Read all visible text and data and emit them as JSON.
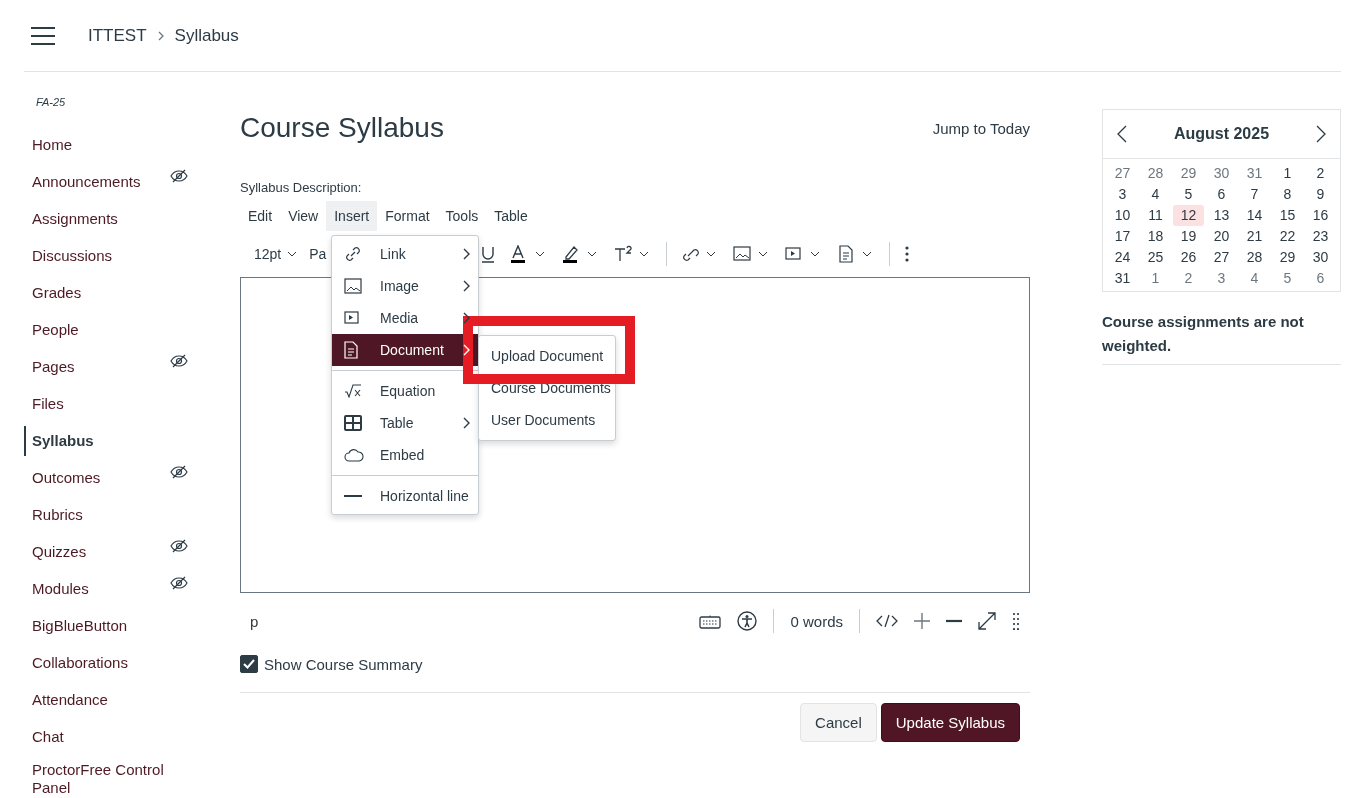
{
  "breadcrumb": [
    "ITTEST",
    "Syllabus"
  ],
  "sidebar": {
    "term": "FA-25",
    "items": [
      {
        "label": "Home",
        "selected": false,
        "hidden": false
      },
      {
        "label": "Announcements",
        "selected": false,
        "hidden": true
      },
      {
        "label": "Assignments",
        "selected": false,
        "hidden": false
      },
      {
        "label": "Discussions",
        "selected": false,
        "hidden": false
      },
      {
        "label": "Grades",
        "selected": false,
        "hidden": false
      },
      {
        "label": "People",
        "selected": false,
        "hidden": false
      },
      {
        "label": "Pages",
        "selected": false,
        "hidden": true
      },
      {
        "label": "Files",
        "selected": false,
        "hidden": false
      },
      {
        "label": "Syllabus",
        "selected": true,
        "hidden": false
      },
      {
        "label": "Outcomes",
        "selected": false,
        "hidden": true
      },
      {
        "label": "Rubrics",
        "selected": false,
        "hidden": false
      },
      {
        "label": "Quizzes",
        "selected": false,
        "hidden": true
      },
      {
        "label": "Modules",
        "selected": false,
        "hidden": true
      },
      {
        "label": "BigBlueButton",
        "selected": false,
        "hidden": false
      },
      {
        "label": "Collaborations",
        "selected": false,
        "hidden": false
      },
      {
        "label": "Attendance",
        "selected": false,
        "hidden": false
      },
      {
        "label": "Chat",
        "selected": false,
        "hidden": false
      },
      {
        "label": "ProctorFree Control Panel",
        "selected": false,
        "hidden": false
      }
    ]
  },
  "page_title": "Course Syllabus",
  "jump_link": "Jump to Today",
  "description_label": "Syllabus Description:",
  "menubar": [
    {
      "label": "Edit",
      "selected": false
    },
    {
      "label": "View",
      "selected": false
    },
    {
      "label": "Insert",
      "selected": true
    },
    {
      "label": "Format",
      "selected": false
    },
    {
      "label": "Tools",
      "selected": false
    },
    {
      "label": "Table",
      "selected": false
    }
  ],
  "toolbar": {
    "font_size": "12pt",
    "paragraph": "Pa"
  },
  "insert_menu": [
    {
      "kind": "link",
      "label": "Link",
      "submenu": true,
      "selected": false,
      "divider_before": false
    },
    {
      "kind": "image",
      "label": "Image",
      "submenu": true,
      "selected": false,
      "divider_before": false
    },
    {
      "kind": "media",
      "label": "Media",
      "submenu": true,
      "selected": false,
      "divider_before": false
    },
    {
      "kind": "document",
      "label": "Document",
      "submenu": true,
      "selected": true,
      "divider_before": false
    },
    {
      "kind": "equation",
      "label": "Equation",
      "submenu": false,
      "selected": false,
      "divider_before": true
    },
    {
      "kind": "table",
      "label": "Table",
      "submenu": true,
      "selected": false,
      "divider_before": false
    },
    {
      "kind": "embed",
      "label": "Embed",
      "submenu": false,
      "selected": false,
      "divider_before": false
    },
    {
      "kind": "hr",
      "label": "Horizontal line",
      "submenu": false,
      "selected": false,
      "divider_before": true
    }
  ],
  "document_submenu": [
    {
      "label": "Upload Document",
      "highlighted": true
    },
    {
      "label": "Course Documents",
      "highlighted": false
    },
    {
      "label": "User Documents",
      "highlighted": false
    }
  ],
  "status_bar": {
    "element_path": "p",
    "word_count": "0 words"
  },
  "show_summary": {
    "label": "Show Course Summary",
    "checked": true
  },
  "buttons": [
    {
      "label": "Cancel",
      "kind": "secondary"
    },
    {
      "label": "Update Syllabus",
      "kind": "primary"
    }
  ],
  "calendar": {
    "title": "August 2025",
    "weeks": [
      [
        {
          "day": "27",
          "outside": true,
          "today": false
        },
        {
          "day": "28",
          "outside": true,
          "today": false
        },
        {
          "day": "29",
          "outside": true,
          "today": false
        },
        {
          "day": "30",
          "outside": true,
          "today": false
        },
        {
          "day": "31",
          "outside": true,
          "today": false
        },
        {
          "day": "1",
          "outside": false,
          "today": false
        },
        {
          "day": "2",
          "outside": false,
          "today": false
        }
      ],
      [
        {
          "day": "3",
          "outside": false,
          "today": false
        },
        {
          "day": "4",
          "outside": false,
          "today": false
        },
        {
          "day": "5",
          "outside": false,
          "today": false
        },
        {
          "day": "6",
          "outside": false,
          "today": false
        },
        {
          "day": "7",
          "outside": false,
          "today": false
        },
        {
          "day": "8",
          "outside": false,
          "today": false
        },
        {
          "day": "9",
          "outside": false,
          "today": false
        }
      ],
      [
        {
          "day": "10",
          "outside": false,
          "today": false
        },
        {
          "day": "11",
          "outside": false,
          "today": false
        },
        {
          "day": "12",
          "outside": false,
          "today": true
        },
        {
          "day": "13",
          "outside": false,
          "today": false
        },
        {
          "day": "14",
          "outside": false,
          "today": false
        },
        {
          "day": "15",
          "outside": false,
          "today": false
        },
        {
          "day": "16",
          "outside": false,
          "today": false
        }
      ],
      [
        {
          "day": "17",
          "outside": false,
          "today": false
        },
        {
          "day": "18",
          "outside": false,
          "today": false
        },
        {
          "day": "19",
          "outside": false,
          "today": false
        },
        {
          "day": "20",
          "outside": false,
          "today": false
        },
        {
          "day": "21",
          "outside": false,
          "today": false
        },
        {
          "day": "22",
          "outside": false,
          "today": false
        },
        {
          "day": "23",
          "outside": false,
          "today": false
        }
      ],
      [
        {
          "day": "24",
          "outside": false,
          "today": false
        },
        {
          "day": "25",
          "outside": false,
          "today": false
        },
        {
          "day": "26",
          "outside": false,
          "today": false
        },
        {
          "day": "27",
          "outside": false,
          "today": false
        },
        {
          "day": "28",
          "outside": false,
          "today": false
        },
        {
          "day": "29",
          "outside": false,
          "today": false
        },
        {
          "day": "30",
          "outside": false,
          "today": false
        }
      ],
      [
        {
          "day": "31",
          "outside": false,
          "today": false
        },
        {
          "day": "1",
          "outside": true,
          "today": false
        },
        {
          "day": "2",
          "outside": true,
          "today": false
        },
        {
          "day": "3",
          "outside": true,
          "today": false
        },
        {
          "day": "4",
          "outside": true,
          "today": false
        },
        {
          "day": "5",
          "outside": true,
          "today": false
        },
        {
          "day": "6",
          "outside": true,
          "today": false
        }
      ]
    ]
  },
  "weighting_note": "Course assignments are not weighted."
}
